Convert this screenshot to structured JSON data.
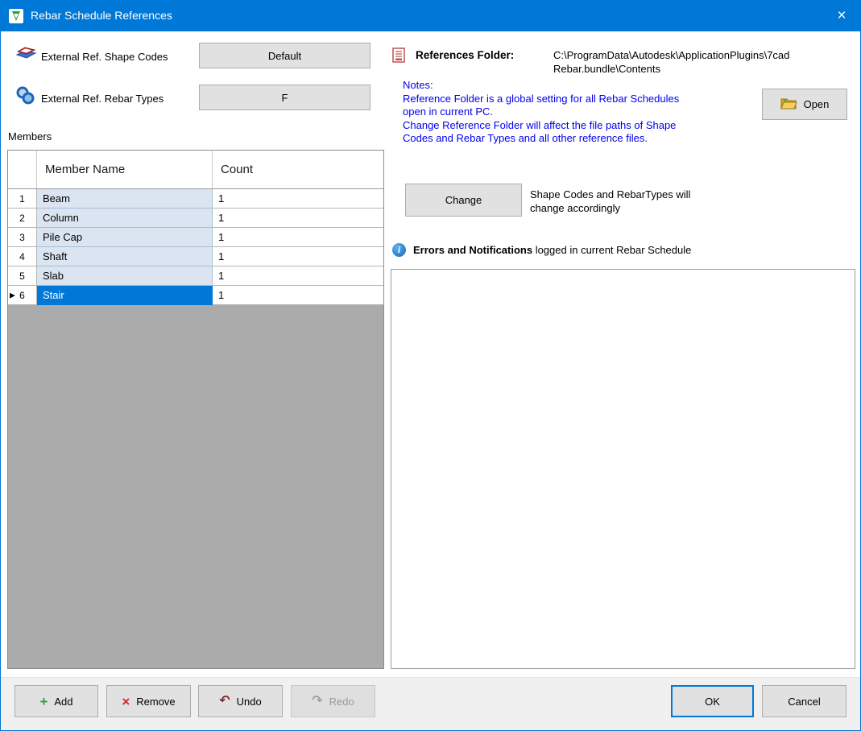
{
  "window": {
    "title": "Rebar Schedule References"
  },
  "icons": {
    "close": "×",
    "row_marker": "▶",
    "add": "+",
    "remove": "×",
    "undo": "↶",
    "redo": "↷",
    "info": "i"
  },
  "left": {
    "shape_codes_label": "External Ref. Shape Codes",
    "shape_codes_value": "Default",
    "rebar_types_label": "External Ref. Rebar Types",
    "rebar_types_value": "F",
    "members_label": "Members",
    "grid": {
      "columns": [
        "Member Name",
        "Count"
      ],
      "rows": [
        {
          "num": "1",
          "name": "Beam",
          "count": "1"
        },
        {
          "num": "2",
          "name": "Column",
          "count": "1"
        },
        {
          "num": "3",
          "name": "Pile Cap",
          "count": "1"
        },
        {
          "num": "4",
          "name": "Shaft",
          "count": "1"
        },
        {
          "num": "5",
          "name": "Slab",
          "count": "1"
        },
        {
          "num": "6",
          "name": "Stair",
          "count": "1"
        }
      ]
    }
  },
  "right": {
    "references_folder_label": "References Folder:",
    "references_folder_value": "C:\\ProgramData\\Autodesk\\ApplicationPlugins\\7cad Rebar.bundle\\Contents",
    "notes_title": "Notes:",
    "note_1": "Reference Folder is a global setting for all Rebar Schedules open in current PC.",
    "note_2": "Change Reference Folder will affect the file paths of Shape Codes and Rebar Types and all other reference files.",
    "open_button": "Open",
    "change_button": "Change",
    "change_note": "Shape Codes and RebarTypes will change accordingly",
    "errors_label_bold": "Errors and Notifications",
    "errors_label_rest": " logged in current Rebar Schedule"
  },
  "footer": {
    "add": "Add",
    "remove": "Remove",
    "undo": "Undo",
    "redo": "Redo",
    "ok": "OK",
    "cancel": "Cancel"
  }
}
